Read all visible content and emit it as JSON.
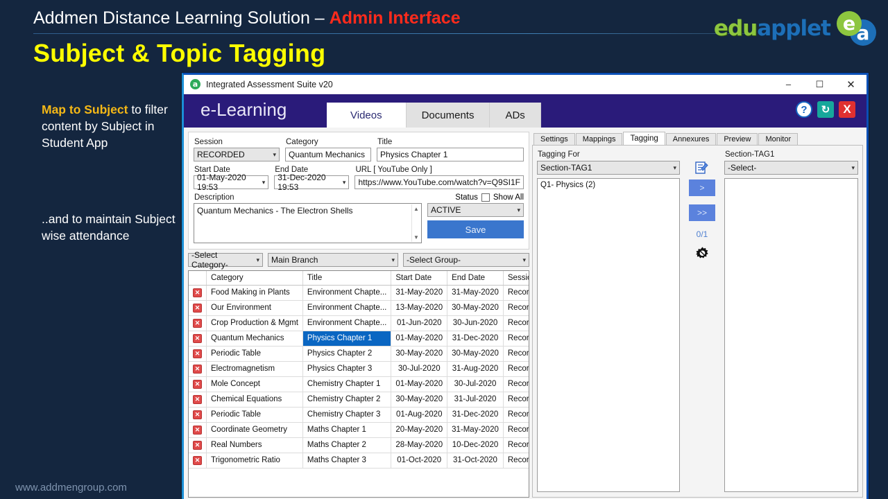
{
  "slide": {
    "title_main": "Addmen Distance Learning Solution – ",
    "title_accent": "Admin Interface",
    "subtitle": "Subject & Topic Tagging",
    "footer_url": "www.addmengroup.com",
    "logo": {
      "part1": "edu",
      "part2": "applet",
      "mark_e": "e",
      "mark_a": "a"
    },
    "notes": [
      {
        "highlight": "Map to Subject",
        "body": " to filter content by Subject in Student App"
      },
      {
        "highlight": "",
        "body": "..and to maintain Subject wise attendance"
      }
    ]
  },
  "window": {
    "app_icon": "a",
    "title": "Integrated Assessment Suite v20",
    "minimize": "–",
    "maximize": "☐",
    "close": "✕"
  },
  "header": {
    "brand": "e-Learning",
    "tabs": [
      {
        "label": "Videos",
        "active": true
      },
      {
        "label": "Documents",
        "active": false
      },
      {
        "label": "ADs",
        "active": false
      }
    ],
    "icons": [
      {
        "name": "help-icon",
        "glyph": "?"
      },
      {
        "name": "refresh-icon",
        "glyph": "↻"
      },
      {
        "name": "close-app-icon",
        "glyph": "X"
      }
    ]
  },
  "form": {
    "session_label": "Session",
    "session_value": "RECORDED",
    "category_label": "Category",
    "category_value": "Quantum Mechanics",
    "title_label": "Title",
    "title_value": "Physics Chapter 1",
    "start_date_label": "Start Date",
    "start_date_value": "01-May-2020 19:53",
    "end_date_label": "End Date",
    "end_date_value": "31-Dec-2020 19:53",
    "url_label": "URL [ YouTube Only ]",
    "url_value": "https://www.YouTube.com/watch?v=Q9SI1F",
    "description_label": "Description",
    "description_value": "Quantum Mechanics - The Electron Shells",
    "status_label": "Status",
    "show_all_label": "Show All",
    "status_value": "ACTIVE",
    "save_label": "Save",
    "filter_category": "-Select Category-",
    "filter_branch": "Main Branch",
    "filter_group": "-Select Group-"
  },
  "table": {
    "columns": [
      "",
      "Category",
      "Title",
      "Start Date",
      "End Date",
      "Session"
    ],
    "delete_glyph": "✕",
    "rows": [
      {
        "category": "Food Making in Plants",
        "title": "Environment Chapte...",
        "start": "31-May-2020",
        "end": "31-May-2020",
        "session": "Recorded",
        "selected": false
      },
      {
        "category": "Our Environment",
        "title": "Environment Chapte...",
        "start": "13-May-2020",
        "end": "30-May-2020",
        "session": "Recorded",
        "selected": false
      },
      {
        "category": "Crop Production & Mgmt",
        "title": "Environment Chapte...",
        "start": "01-Jun-2020",
        "end": "30-Jun-2020",
        "session": "Recorded",
        "selected": false
      },
      {
        "category": "Quantum Mechanics",
        "title": "Physics Chapter 1",
        "start": "01-May-2020",
        "end": "31-Dec-2020",
        "session": "Recorded",
        "selected": true
      },
      {
        "category": "Periodic Table",
        "title": "Physics Chapter 2",
        "start": "30-May-2020",
        "end": "30-May-2020",
        "session": "Recorded",
        "selected": false
      },
      {
        "category": "Electromagnetism",
        "title": "Physics Chapter 3",
        "start": "30-Jul-2020",
        "end": "31-Aug-2020",
        "session": "Recorded",
        "selected": false
      },
      {
        "category": "Mole Concept",
        "title": "Chemistry Chapter 1",
        "start": "01-May-2020",
        "end": "30-Jul-2020",
        "session": "Recorded",
        "selected": false
      },
      {
        "category": "Chemical Equations",
        "title": "Chemistry Chapter 2",
        "start": "30-May-2020",
        "end": "31-Jul-2020",
        "session": "Recorded",
        "selected": false
      },
      {
        "category": "Periodic Table",
        "title": "Chemistry Chapter 3",
        "start": "01-Aug-2020",
        "end": "31-Dec-2020",
        "session": "Recorded",
        "selected": false
      },
      {
        "category": "Coordinate Geometry",
        "title": "Maths Chapter 1",
        "start": "20-May-2020",
        "end": "31-May-2020",
        "session": "Recorded",
        "selected": false
      },
      {
        "category": "Real Numbers",
        "title": "Maths Chapter 2",
        "start": "28-May-2020",
        "end": "10-Dec-2020",
        "session": "Recorded",
        "selected": false
      },
      {
        "category": "Trigonometric Ratio",
        "title": "Maths Chapter 3",
        "start": "01-Oct-2020",
        "end": "31-Oct-2020",
        "session": "Recorded",
        "selected": false
      }
    ]
  },
  "right": {
    "tabs": [
      {
        "label": "Settings",
        "active": false
      },
      {
        "label": "Mappings",
        "active": false
      },
      {
        "label": "Tagging",
        "active": true
      },
      {
        "label": "Annexures",
        "active": false
      },
      {
        "label": "Preview",
        "active": false
      },
      {
        "label": "Monitor",
        "active": false
      }
    ],
    "tagging_for_label": "Tagging For",
    "tagging_for_value": "Section-TAG1",
    "section_label": "Section-TAG1",
    "section_value": "-Select-",
    "list_item": "Q1- Physics (2)",
    "move_one": ">",
    "move_all": ">>",
    "counter": "0/1",
    "edit_icon": "✎",
    "gear_icon": "⚙"
  }
}
